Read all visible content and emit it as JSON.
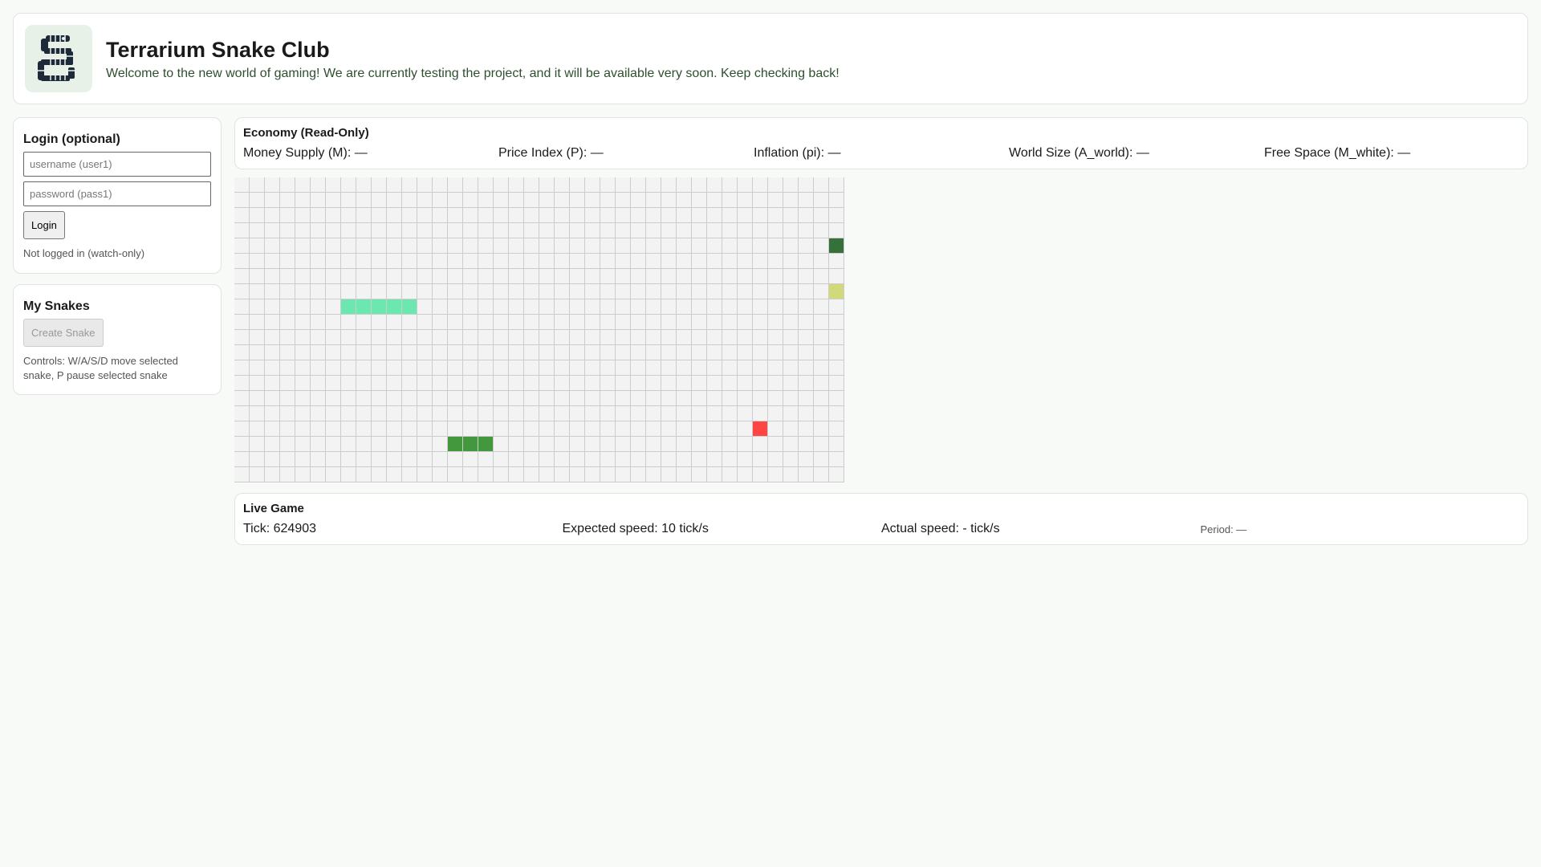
{
  "header": {
    "title": "Terrarium Snake Club",
    "subtitle": "Welcome to the new world of gaming! We are currently testing the project, and it will be available very soon. Keep checking back!",
    "logo": "snake-logo-icon"
  },
  "login": {
    "heading": "Login (optional)",
    "username_placeholder": "username (user1)",
    "password_placeholder": "password (pass1)",
    "button": "Login",
    "status": "Not logged in (watch-only)"
  },
  "my_snakes": {
    "heading": "My Snakes",
    "create_button": "Create Snake",
    "controls": "Controls: W/A/S/D move selected snake, P pause selected snake"
  },
  "economy": {
    "heading": "Economy (Read-Only)",
    "items": [
      "Money Supply (M): —",
      "Price Index (P): —",
      "Inflation (pi): —",
      "World Size (A_world): —",
      "Free Space (M_white): —"
    ]
  },
  "board": {
    "cols": 40,
    "rows": 20,
    "cells": [
      {
        "col": 7,
        "row": 8,
        "color": "#6ae8b0"
      },
      {
        "col": 8,
        "row": 8,
        "color": "#6ae8b0"
      },
      {
        "col": 9,
        "row": 8,
        "color": "#6ae8b0"
      },
      {
        "col": 10,
        "row": 8,
        "color": "#6ae8b0"
      },
      {
        "col": 11,
        "row": 8,
        "color": "#6ae8b0"
      },
      {
        "col": 39,
        "row": 4,
        "color": "#36703a"
      },
      {
        "col": 39,
        "row": 7,
        "color": "#d2d97a"
      },
      {
        "col": 34,
        "row": 16,
        "color": "#ff4444"
      },
      {
        "col": 14,
        "row": 17,
        "color": "#43983d"
      },
      {
        "col": 15,
        "row": 17,
        "color": "#43983d"
      },
      {
        "col": 16,
        "row": 17,
        "color": "#43983d"
      }
    ]
  },
  "live": {
    "heading": "Live Game",
    "tick": "Tick: 624903",
    "expected": "Expected speed: 10 tick/s",
    "actual": "Actual speed: - tick/s",
    "period": "Period: —"
  }
}
